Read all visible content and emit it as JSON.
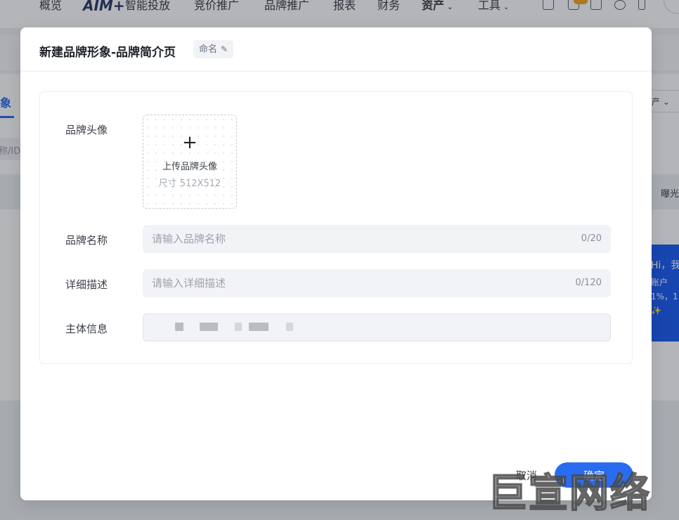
{
  "background": {
    "logo": "AIM+",
    "nav": [
      "概览",
      "智能投放",
      "竞价推广",
      "品牌推广",
      "报表",
      "财务",
      "资产",
      "工具"
    ],
    "active_tab": "象",
    "search_placeholder": "称/ID",
    "filter_text": "产",
    "column_header": "曝光",
    "promo_lines": [
      "Hi，我",
      "账户",
      "1%，1",
      "✨"
    ]
  },
  "modal": {
    "title": "新建品牌形象-品牌简介页",
    "rename_label": "命名",
    "avatar": {
      "label": "品牌头像",
      "upload_text": "上传品牌头像",
      "size_hint": "尺寸 512X512"
    },
    "name": {
      "label": "品牌名称",
      "placeholder": "请输入品牌名称",
      "value": "",
      "counter": "0/20"
    },
    "description": {
      "label": "详细描述",
      "placeholder": "请输入详细描述",
      "value": "",
      "counter": "0/120"
    },
    "entity": {
      "label": "主体信息"
    },
    "cancel_label": "取消",
    "ok_label": "确定"
  },
  "watermark": "巨宣网络",
  "colors": {
    "primary": "#2a6cf0",
    "field_bg": "#f2f3f6",
    "text": "#1f2329",
    "placeholder": "#9ca2ab"
  }
}
